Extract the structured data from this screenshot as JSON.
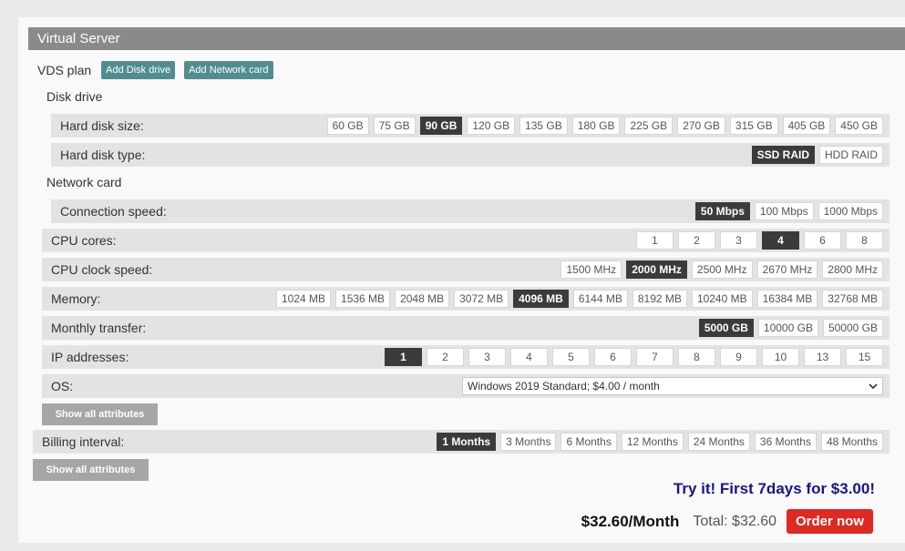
{
  "header": {
    "title": "Virtual Server"
  },
  "vds": {
    "label": "VDS plan",
    "add_disk_label": "Add Disk drive",
    "add_network_label": "Add Network card"
  },
  "disk_drive": {
    "section_label": "Disk drive",
    "size": {
      "label": "Hard disk size:",
      "options": [
        "60 GB",
        "75 GB",
        "90 GB",
        "120 GB",
        "135 GB",
        "180 GB",
        "225 GB",
        "270 GB",
        "315 GB",
        "405 GB",
        "450 GB"
      ],
      "selected": "90 GB"
    },
    "type": {
      "label": "Hard disk type:",
      "options": [
        "SSD RAID",
        "HDD RAID"
      ],
      "selected": "SSD RAID"
    }
  },
  "network_card": {
    "section_label": "Network card",
    "speed": {
      "label": "Connection speed:",
      "options": [
        "50 Mbps",
        "100 Mbps",
        "1000 Mbps"
      ],
      "selected": "50 Mbps"
    }
  },
  "cpu_cores": {
    "label": "CPU cores:",
    "options": [
      "1",
      "2",
      "3",
      "4",
      "6",
      "8"
    ],
    "selected": "4"
  },
  "cpu_clock": {
    "label": "CPU clock speed:",
    "options": [
      "1500 MHz",
      "2000 MHz",
      "2500 MHz",
      "2670 MHz",
      "2800 MHz"
    ],
    "selected": "2000 MHz"
  },
  "memory": {
    "label": "Memory:",
    "options": [
      "1024 MB",
      "1536 MB",
      "2048 MB",
      "3072 MB",
      "4096 MB",
      "6144 MB",
      "8192 MB",
      "10240 MB",
      "16384 MB",
      "32768 MB"
    ],
    "selected": "4096 MB"
  },
  "transfer": {
    "label": "Monthly transfer:",
    "options": [
      "5000 GB",
      "10000 GB",
      "50000 GB"
    ],
    "selected": "5000 GB"
  },
  "ip": {
    "label": "IP addresses:",
    "options": [
      "1",
      "2",
      "3",
      "4",
      "5",
      "6",
      "7",
      "8",
      "9",
      "10",
      "13",
      "15"
    ],
    "selected": "1"
  },
  "os": {
    "label": "OS:",
    "value": "Windows 2019 Standard; $4.00 / month"
  },
  "show_all_label": "Show all attributes",
  "billing": {
    "label": "Billing interval:",
    "options": [
      "1 Months",
      "3 Months",
      "6 Months",
      "12 Months",
      "24 Months",
      "36 Months",
      "48 Months"
    ],
    "selected": "1 Months"
  },
  "promo_text": "Try it! First 7days for $3.00!",
  "price": {
    "monthly": "$32.60/Month",
    "total": "Total: $32.60"
  },
  "order_label": "Order now"
}
